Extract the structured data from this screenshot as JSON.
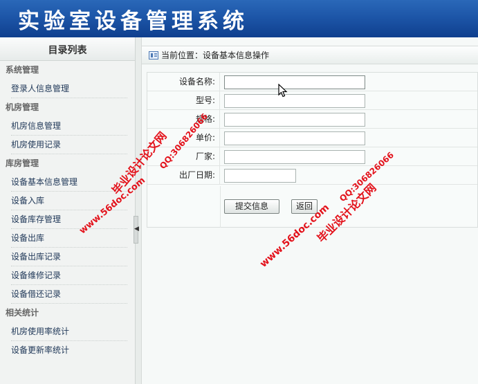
{
  "header": {
    "title": "实验室设备管理系统"
  },
  "sidebar": {
    "title": "目录列表",
    "groups": [
      {
        "label": "系统管理",
        "items": [
          "登录人信息管理"
        ]
      },
      {
        "label": "机房管理",
        "items": [
          "机房信息管理",
          "机房使用记录"
        ]
      },
      {
        "label": "库房管理",
        "items": [
          "设备基本信息管理",
          "设备入库",
          "设备库存管理",
          "设备出库",
          "设备出库记录",
          "设备维修记录",
          "设备借还记录"
        ]
      },
      {
        "label": "相关统计",
        "items": [
          "机房使用率统计",
          "设备更新率统计"
        ]
      }
    ]
  },
  "breadcrumb": {
    "text": "当前位置：设备基本信息操作"
  },
  "form": {
    "fields": [
      {
        "label": "设备名称:",
        "value": ""
      },
      {
        "label": "型号:",
        "value": ""
      },
      {
        "label": "规格:",
        "value": ""
      },
      {
        "label": "单价:",
        "value": ""
      },
      {
        "label": "厂家:",
        "value": ""
      },
      {
        "label": "出厂日期:",
        "value": ""
      }
    ],
    "submit_label": "提交信息",
    "back_label": "返回"
  },
  "watermarks": {
    "site_1": "毕业设计论文网",
    "qq_1": "QQ:306826066",
    "url_1": "www.56doc.com",
    "qq_2": "QQ:306826066",
    "url_2": "www.56doc.com",
    "site_2": "毕业设计论文网"
  },
  "colors": {
    "banner": "#1d56a8",
    "watermark": "#e3121b"
  }
}
